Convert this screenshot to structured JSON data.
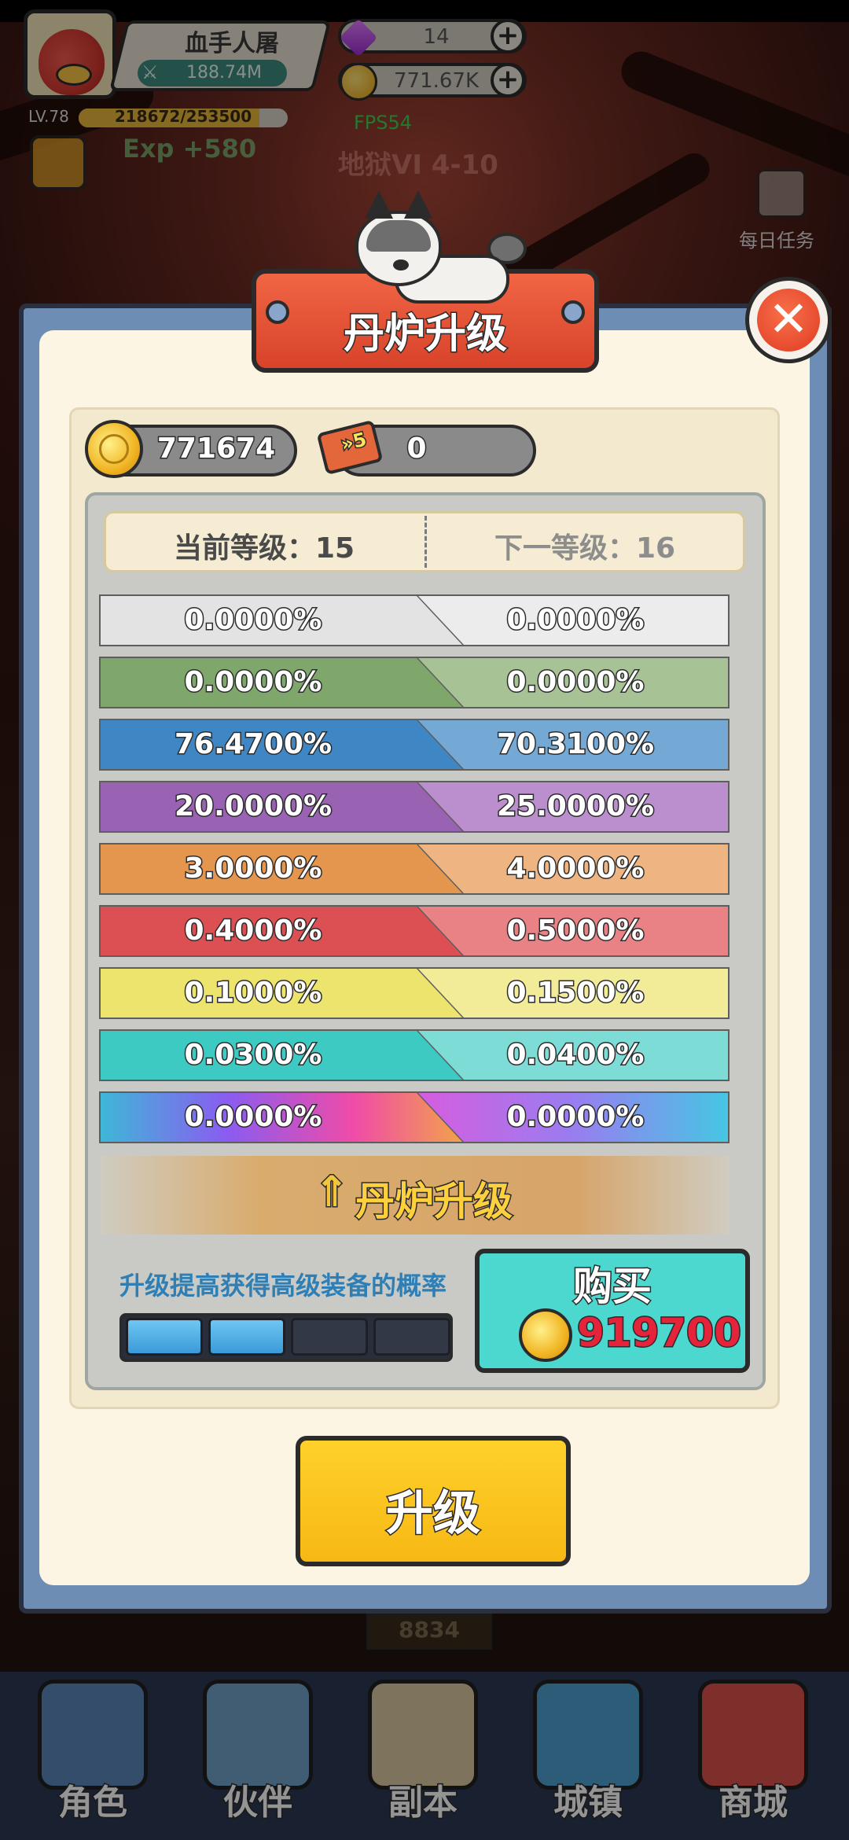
{
  "hud": {
    "player_name": "血手人屠",
    "power": "188.74M",
    "gems": "14",
    "gold": "771.67K",
    "level": "LV.78",
    "exp_text": "218672/253500",
    "exp_fraction": 0.863,
    "exp_gain": "Exp +580",
    "fps": "FPS54",
    "stage": "地狱VI 4-10",
    "daily_task": "每日任务",
    "plus_symbol": "+"
  },
  "panel": {
    "title": "丹炉升级",
    "close_symbol": "✕",
    "coin_amount": "771674",
    "ticket_amount": "0",
    "ticket_badge": "»5",
    "current_level_label": "当前等级：15",
    "next_level_label": "下一等级：16",
    "probability_rows": [
      {
        "current": "0.0000%",
        "next": "0.0000%",
        "color_left": "#e3e3e3",
        "color_right": "#ececec"
      },
      {
        "current": "0.0000%",
        "next": "0.0000%",
        "color_left": "#7fa66b",
        "color_right": "#a7c294"
      },
      {
        "current": "76.4700%",
        "next": "70.3100%",
        "color_left": "#3f87c4",
        "color_right": "#74a9d6"
      },
      {
        "current": "20.0000%",
        "next": "25.0000%",
        "color_left": "#9a62b3",
        "color_right": "#bb8fcd"
      },
      {
        "current": "3.0000%",
        "next": "4.0000%",
        "color_left": "#e4964f",
        "color_right": "#eeb583"
      },
      {
        "current": "0.4000%",
        "next": "0.5000%",
        "color_left": "#dc5053",
        "color_right": "#e88285"
      },
      {
        "current": "0.1000%",
        "next": "0.1500%",
        "color_left": "#ece46c",
        "color_right": "#f2ec99"
      },
      {
        "current": "0.0300%",
        "next": "0.0400%",
        "color_left": "#3ccac2",
        "color_right": "#7ddcd6"
      },
      {
        "current": "0.0000%",
        "next": "0.0000%",
        "color_left": "linear-gradient(90deg,#3fb7d8,#8a5cf0 35%,#f04ba8 70%,#f2a24a)",
        "color_right": "linear-gradient(90deg,#f06a9a,#f050d8 40%,#9a7cf0 75%,#46c6e4)"
      }
    ],
    "upgrade_banner_icon": "⇑",
    "upgrade_banner_text": "丹炉升级",
    "upgrade_description": "升级提高获得高级装备的概率",
    "segments_total": 4,
    "segments_filled": 2,
    "buy_label": "购买",
    "buy_cost": "919700",
    "main_button_label": "升级"
  },
  "background": {
    "plate_number": "8834"
  },
  "nav": {
    "items": [
      {
        "label": "角色",
        "color": "#5b86b8"
      },
      {
        "label": "伙伴",
        "color": "#6ea0c9"
      },
      {
        "label": "副本",
        "color": "#d9c7a0"
      },
      {
        "label": "城镇",
        "color": "#4f9fcf"
      },
      {
        "label": "商城",
        "color": "#d9524a"
      }
    ]
  }
}
